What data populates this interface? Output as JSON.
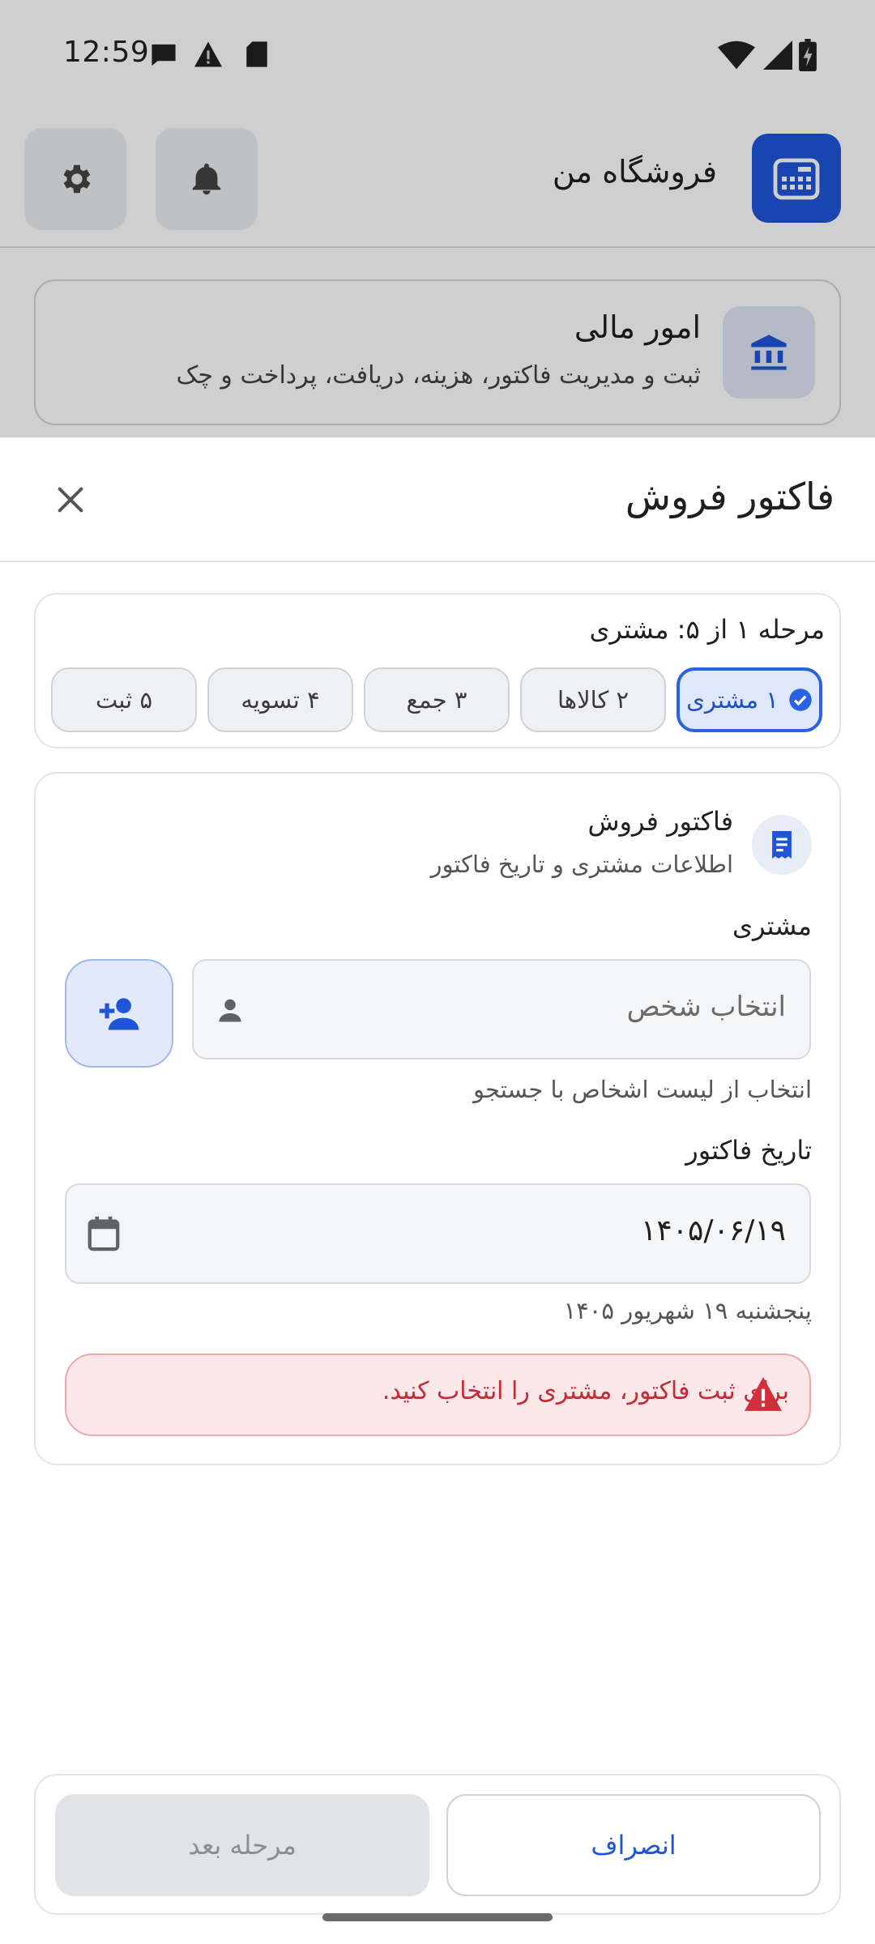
{
  "status_bar": {
    "time": "12:59"
  },
  "app_bar": {
    "title": "فروشگاه من"
  },
  "finance_card": {
    "title": "امور مالی",
    "subtitle": "ثبت و مدیریت فاکتور، هزینه، دریافت، پرداخت و چک"
  },
  "sheet": {
    "title": "فاکتور فروش",
    "step_label": "مرحله ۱ از ۵: مشتری",
    "steps": [
      {
        "label": "۱ مشتری",
        "active": true
      },
      {
        "label": "۲ کالاها",
        "active": false
      },
      {
        "label": "۳ جمع",
        "active": false
      },
      {
        "label": "۴ تسویه",
        "active": false
      },
      {
        "label": "۵ ثبت",
        "active": false
      }
    ],
    "form": {
      "title": "فاکتور فروش",
      "subtitle": "اطلاعات مشتری و تاریخ فاکتور",
      "customer_label": "مشتری",
      "customer_placeholder": "انتخاب شخص",
      "customer_helper": "انتخاب از لیست اشخاص با جستجو",
      "date_label": "تاریخ فاکتور",
      "date_value": "۱۴۰۵/۰۶/۱۹",
      "date_helper": "پنجشنبه ۱۹ شهریور ۱۴۰۵",
      "error": "برای ثبت فاکتور، مشتری را انتخاب کنید."
    },
    "actions": {
      "cancel": "انصراف",
      "next": "مرحله بعد"
    }
  },
  "colors": {
    "accent": "#1f56d9",
    "error": "#c42b34",
    "error_bg": "#fde8e9"
  }
}
